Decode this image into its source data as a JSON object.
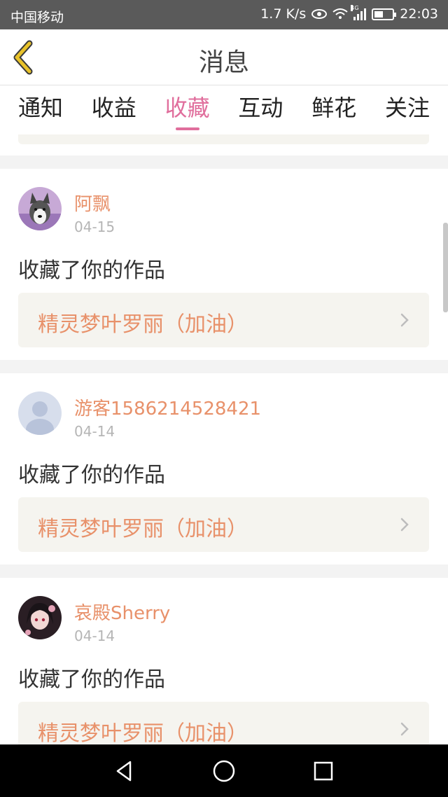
{
  "status_bar": {
    "carrier": "中国移动",
    "network_speed": "1.7 K/s",
    "network_type": "4G",
    "time": "22:03"
  },
  "header": {
    "title": "消息",
    "back_icon": "chevron-left-icon"
  },
  "tabs": [
    {
      "label": "通知",
      "active": false
    },
    {
      "label": "收益",
      "active": false
    },
    {
      "label": "收藏",
      "active": true
    },
    {
      "label": "互动",
      "active": false
    },
    {
      "label": "鲜花",
      "active": false
    },
    {
      "label": "关注",
      "active": false
    }
  ],
  "feed": [
    {
      "username": "阿飘",
      "date": "04-15",
      "action": "收藏了你的作品",
      "work_title": "精灵梦叶罗丽（加油）",
      "avatar": "husky-dog-avatar"
    },
    {
      "username": "游客1586214528421",
      "date": "04-14",
      "action": "收藏了你的作品",
      "work_title": "精灵梦叶罗丽（加油）",
      "avatar": "default-user-avatar"
    },
    {
      "username": "哀殿Sherry",
      "date": "04-14",
      "action": "收藏了你的作品",
      "work_title": "精灵梦叶罗丽（加油）",
      "avatar": "anime-girl-avatar"
    }
  ],
  "colors": {
    "accent_pink": "#e06e9c",
    "username_orange": "#e8916a",
    "work_box_bg": "#f5f4ef",
    "back_icon_yellow": "#e8c22a"
  },
  "nav_bar": {
    "back_icon": "triangle-back-icon",
    "home_icon": "circle-home-icon",
    "recents_icon": "square-recents-icon"
  }
}
